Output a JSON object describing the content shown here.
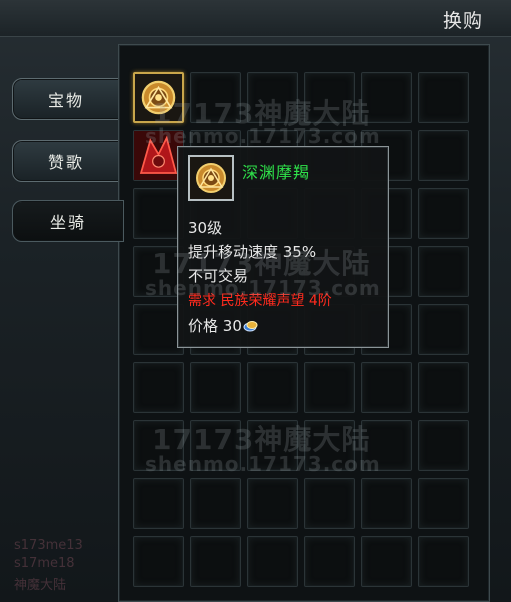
{
  "window": {
    "title": "换购"
  },
  "tabs": [
    {
      "label": "宝物",
      "active": false
    },
    {
      "label": "赞歌",
      "active": false
    },
    {
      "label": "坐骑",
      "active": true
    }
  ],
  "grid": {
    "rows": 9,
    "cols": 6,
    "items": [
      {
        "row": 0,
        "col": 0,
        "icon": "golden-seal-mount-icon",
        "selected": true
      },
      {
        "row": 1,
        "col": 0,
        "icon": "red-mount-icon",
        "selected": false
      }
    ]
  },
  "tooltip": {
    "icon": "golden-seal-mount-icon",
    "name": "深渊摩羯",
    "level": "30级",
    "effect": "提升移动速度 35%",
    "trade": "不可交易",
    "requirement": "需求 民族荣耀声望 4阶",
    "price_label": "价格",
    "price_value": "30",
    "currency_icon": "coin-icon"
  },
  "watermarks": {
    "big": "17173神魔大陆",
    "url": "shenmo.17173.com"
  },
  "corner_lines": [
    "s173me13",
    "s17me18",
    "神魔大陆"
  ],
  "colors": {
    "item_name": "#2fe24a",
    "requirement": "#ff2b1e",
    "selected_border": "#c9a64b"
  }
}
